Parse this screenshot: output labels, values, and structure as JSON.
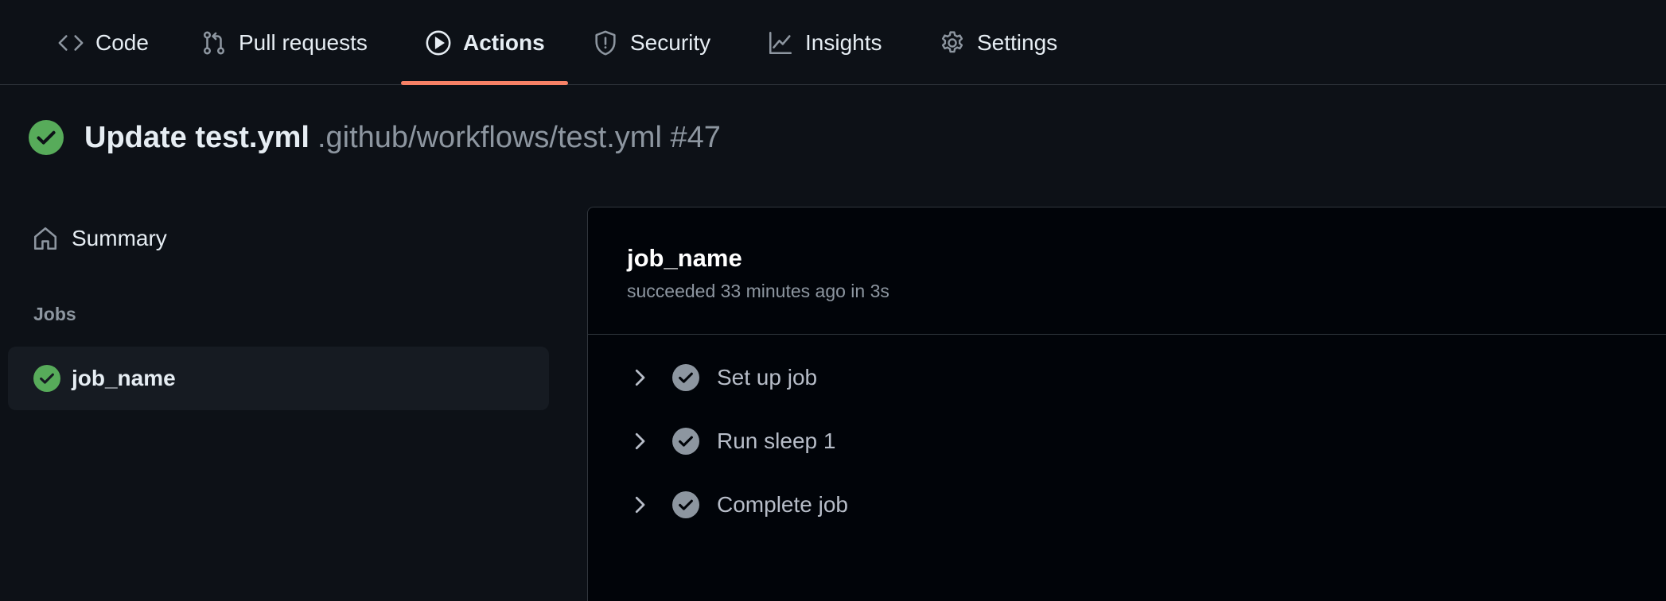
{
  "nav": {
    "tabs": [
      {
        "label": "Code",
        "icon": "code-icon",
        "active": false
      },
      {
        "label": "Pull requests",
        "icon": "git-pull-request-icon",
        "active": false
      },
      {
        "label": "Actions",
        "icon": "play-icon",
        "active": true
      },
      {
        "label": "Security",
        "icon": "shield-icon",
        "active": false
      },
      {
        "label": "Insights",
        "icon": "graph-icon",
        "active": false
      },
      {
        "label": "Settings",
        "icon": "gear-icon",
        "active": false
      }
    ]
  },
  "run": {
    "title": "Update test.yml",
    "workflow_path": ".github/workflows/test.yml #47",
    "status": "success"
  },
  "sidebar": {
    "summary_label": "Summary",
    "jobs_heading": "Jobs",
    "jobs": [
      {
        "name": "job_name",
        "status": "success",
        "selected": true
      }
    ]
  },
  "job": {
    "name": "job_name",
    "status_text": "succeeded 33 minutes ago in 3s",
    "steps": [
      {
        "label": "Set up job",
        "status": "success"
      },
      {
        "label": "Run sleep 1",
        "status": "success"
      },
      {
        "label": "Complete job",
        "status": "success"
      }
    ]
  },
  "colors": {
    "background": "#0d1117",
    "panel": "#010409",
    "success": "#57ab5a",
    "active_tab_underline": "#f78166",
    "muted_text": "#8d96a0"
  }
}
